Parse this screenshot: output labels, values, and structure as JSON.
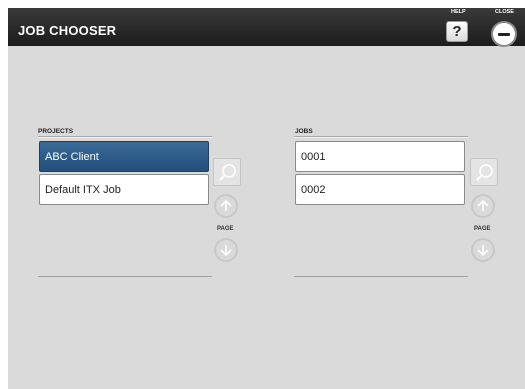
{
  "window": {
    "title": "JOB CHOOSER",
    "help_label": "HELP",
    "close_label": "CLOSE",
    "help_glyph": "?"
  },
  "projects": {
    "heading": "PROJECTS",
    "items": [
      {
        "label": "ABC Client",
        "selected": true
      },
      {
        "label": "Default ITX Job",
        "selected": false
      }
    ],
    "page_label": "PAGE"
  },
  "jobs": {
    "heading": "JOBS",
    "items": [
      {
        "label": "0001",
        "selected": false
      },
      {
        "label": "0002",
        "selected": false
      }
    ],
    "page_label": "PAGE"
  },
  "colors": {
    "title_bar": "#1f1f1f",
    "selected_item": "#2d5a87",
    "background": "#dadada"
  },
  "icons": {
    "help": "question-mark-icon",
    "close": "minus-circle-icon",
    "search": "magnifier-icon",
    "page_up": "arrow-up-icon",
    "page_down": "arrow-down-icon"
  }
}
